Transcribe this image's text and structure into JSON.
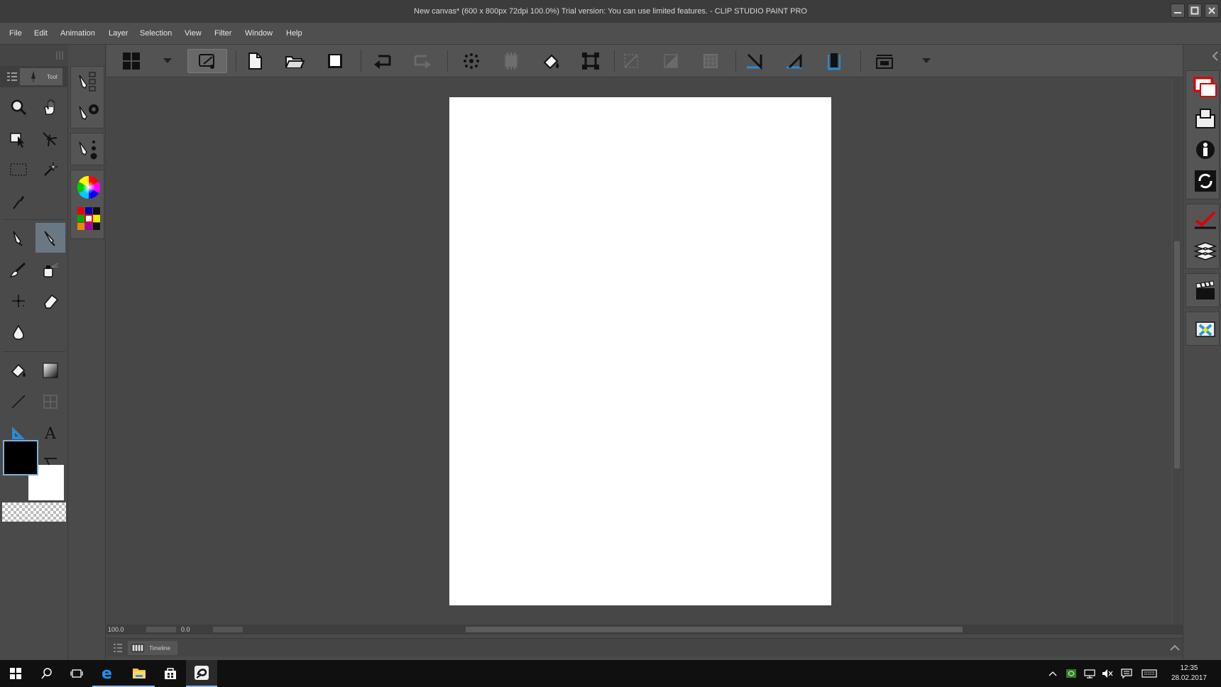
{
  "window": {
    "title": "New canvas* (600 x 800px 72dpi 100.0%)  Trial version: You can use limited features. - CLIP STUDIO PAINT PRO"
  },
  "menu": [
    "File",
    "Edit",
    "Animation",
    "Layer",
    "Selection",
    "View",
    "Filter",
    "Window",
    "Help"
  ],
  "command_bar": {
    "items": [
      "workspace-grid-icon",
      "dropdown-icon",
      "launch-clip-studio-icon",
      "new-document-icon",
      "open-folder-icon",
      "save-icon",
      "undo-icon",
      "redo-icon",
      "clear-icon",
      "fill-icon",
      "bucket-icon",
      "transform-icon",
      "hide-selection-icon",
      "clear-selection-icon",
      "crop-icon",
      "ruler-icon",
      "perspective-icon",
      "snap-icon",
      "display-icon",
      "more-icon"
    ]
  },
  "tool_palette": {
    "tab_label": "Tool",
    "tools": [
      "zoom",
      "hand",
      "operation",
      "move-layer",
      "selection",
      "auto-select",
      "eyedropper",
      "pen",
      "pencil",
      "brush",
      "airbrush",
      "decoration",
      "eraser",
      "blend",
      "fill",
      "gradient",
      "figure",
      "frame-border",
      "ruler",
      "text",
      "balloon",
      "correct-line"
    ],
    "main_color": "#000000",
    "sub_color": "#ffffff"
  },
  "status": {
    "zoom": "100.0",
    "rotation": "0.0"
  },
  "timeline": {
    "tab_label": "Timeline"
  },
  "taskbar": {
    "time": "12:35",
    "date": "28.02.2017"
  }
}
